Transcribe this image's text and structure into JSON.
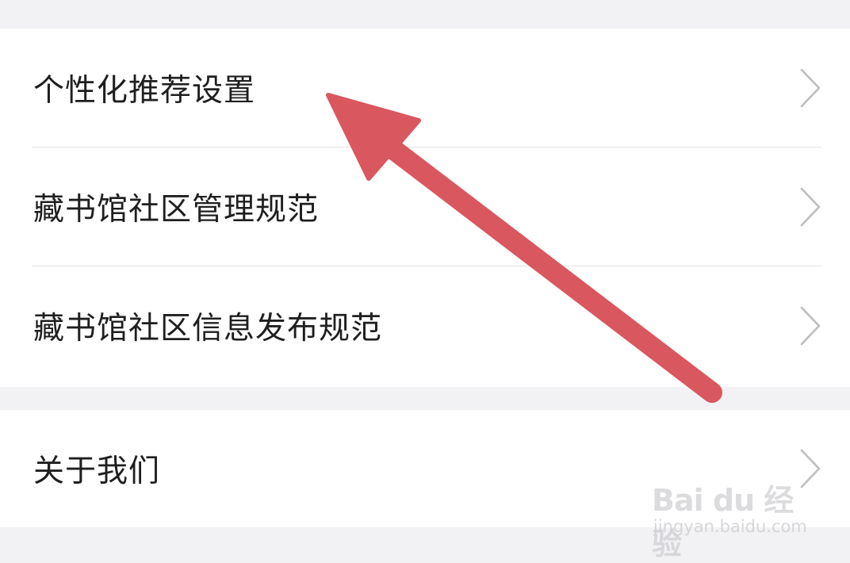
{
  "settings": {
    "items": [
      {
        "label": "个性化推荐设置"
      },
      {
        "label": "藏书馆社区管理规范"
      },
      {
        "label": "藏书馆社区信息发布规范"
      },
      {
        "label": "关于我们"
      }
    ],
    "chevron_icon": "chevron-right-icon"
  },
  "annotation": {
    "icon": "red-arrow",
    "color": "#d9575f"
  },
  "watermark": {
    "brand": "Bai du 经验",
    "url": "jingyan.baidu.com"
  }
}
